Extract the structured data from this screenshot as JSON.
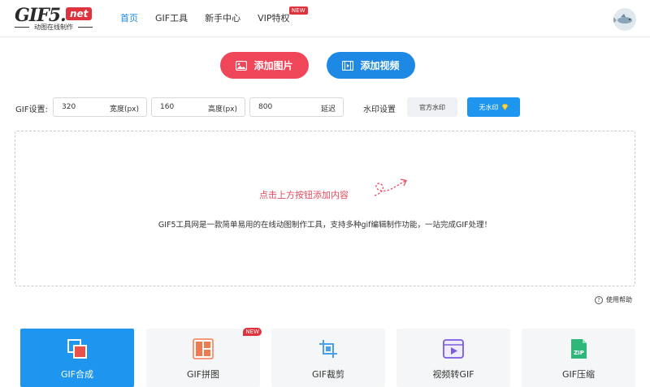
{
  "logo": {
    "main": "GIF5.",
    "net": "net",
    "sub": "动图在线制作"
  },
  "nav": {
    "items": [
      {
        "label": "首页",
        "active": true
      },
      {
        "label": "GIF工具",
        "active": false
      },
      {
        "label": "新手中心",
        "active": false
      },
      {
        "label": "VIP特权",
        "active": false,
        "badge": "NEW"
      }
    ]
  },
  "actions": {
    "add_image": "添加图片",
    "add_video": "添加视频"
  },
  "settings": {
    "label": "GIF设置:",
    "width": {
      "value": "320",
      "unit": "宽度(px)"
    },
    "height": {
      "value": "160",
      "unit": "高度(px)"
    },
    "delay": {
      "value": "800",
      "unit": "延迟"
    },
    "watermark_label": "水印设置",
    "watermark_official": "官方水印",
    "watermark_none": "无水印"
  },
  "dropzone": {
    "hint": "点击上方按钮添加内容",
    "description": "GIF5工具网是一款简单易用的在线动图制作工具，支持多种gif编辑制作功能，一站完成GIF处理！"
  },
  "help": {
    "label": "使用帮助"
  },
  "tools": [
    {
      "label": "GIF合成",
      "icon": "layers-icon",
      "active": true
    },
    {
      "label": "GIF拼图",
      "icon": "collage-icon",
      "active": false,
      "badge": "NEW"
    },
    {
      "label": "GIF裁剪",
      "icon": "crop-icon",
      "active": false
    },
    {
      "label": "视频转GIF",
      "icon": "video-convert-icon",
      "active": false
    },
    {
      "label": "GIF压缩",
      "icon": "zip-icon",
      "active": false
    }
  ],
  "colors": {
    "primary": "#1e88e5",
    "accent_red": "#f0465a",
    "badge_red": "#e0323c"
  }
}
